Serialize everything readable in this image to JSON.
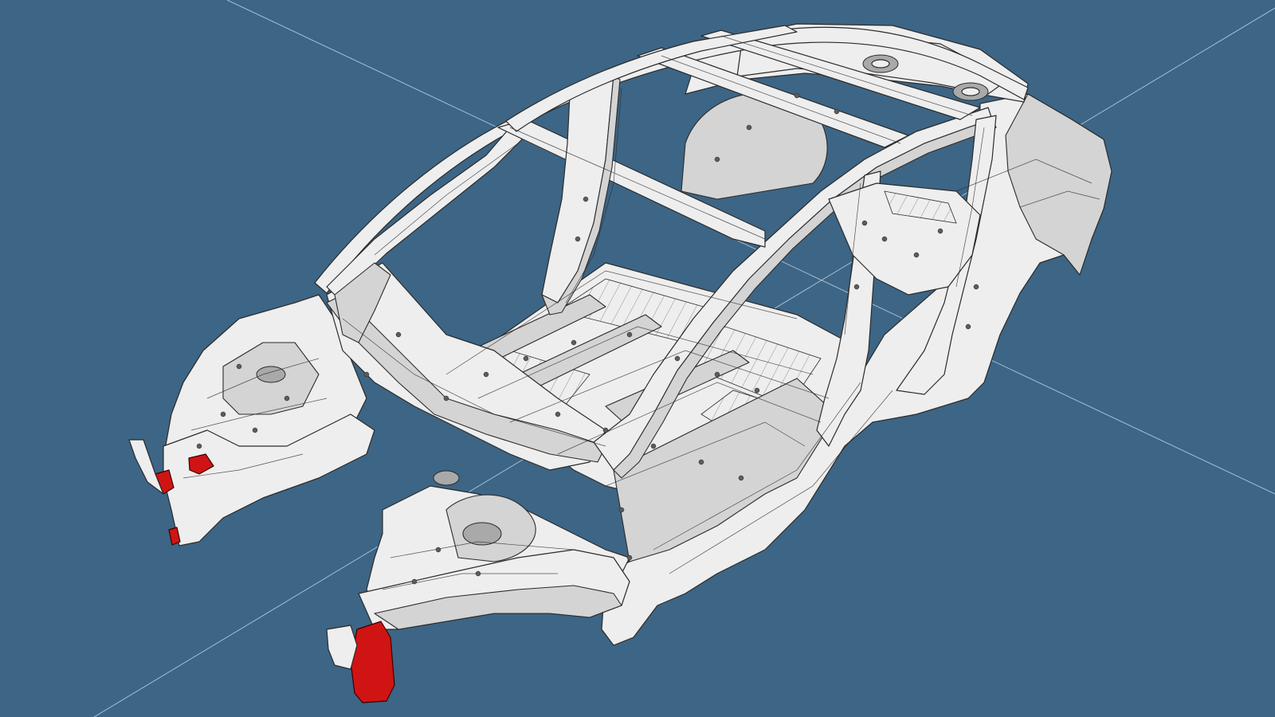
{
  "viewer": {
    "background_color": "#3d6585",
    "axis_line_color": "#b9cfe0",
    "model_fill_color": "#eeeeee",
    "model_shade_color": "#d4d4d4",
    "model_dark_color": "#a9a9a9",
    "model_edge_color": "#2b2b2b",
    "highlight_color": "#d01414",
    "model_name": "car-body-in-white",
    "view": "isometric-front-left",
    "highlighted_parts": [
      "front-bumper-bracket-left",
      "front-bumper-bracket-right"
    ]
  }
}
